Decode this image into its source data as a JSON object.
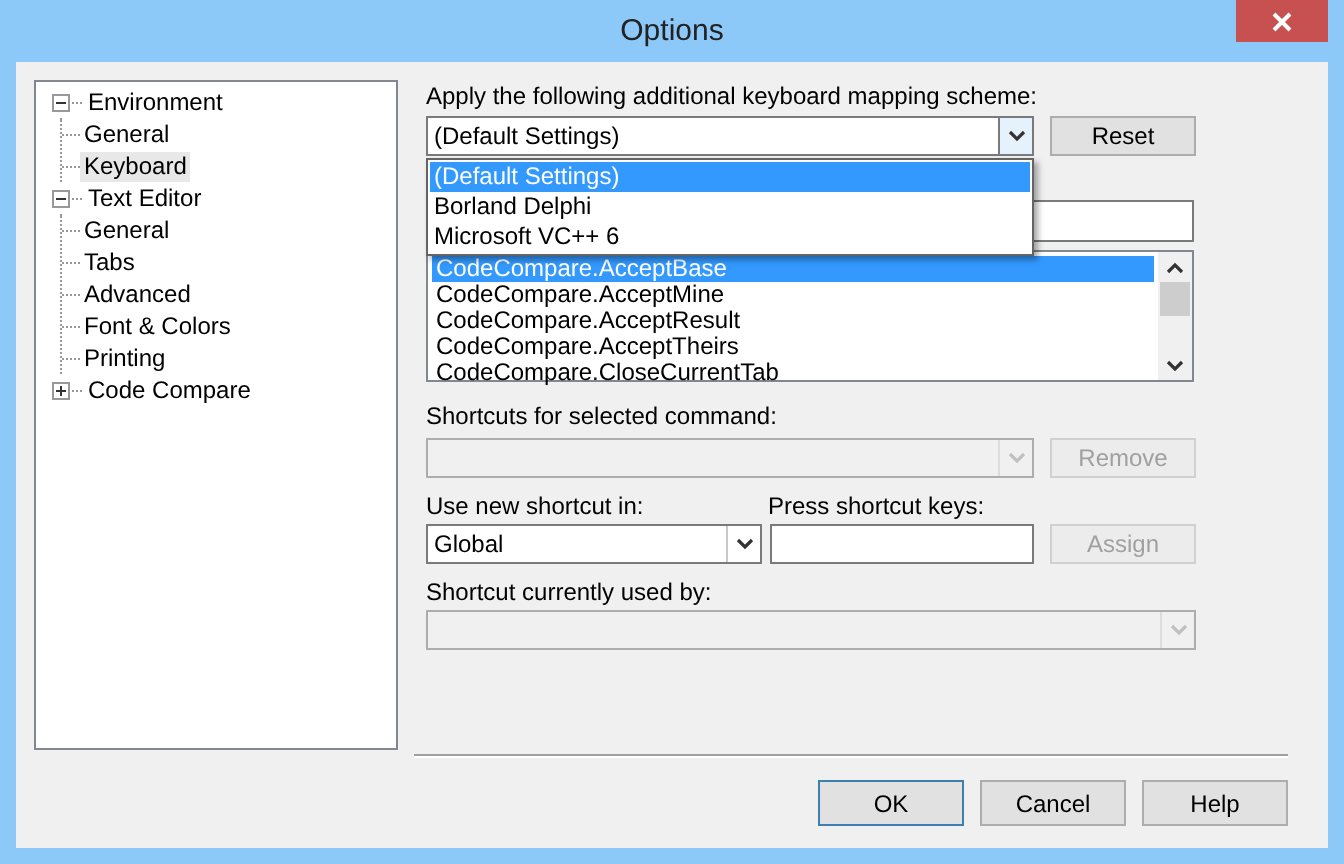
{
  "window": {
    "title": "Options"
  },
  "tree": [
    {
      "label": "Environment",
      "expanded": true,
      "selected": false,
      "children": [
        {
          "label": "General",
          "selected": false
        },
        {
          "label": "Keyboard",
          "selected": true
        }
      ]
    },
    {
      "label": "Text Editor",
      "expanded": true,
      "selected": false,
      "children": [
        {
          "label": "General",
          "selected": false
        },
        {
          "label": "Tabs",
          "selected": false
        },
        {
          "label": "Advanced",
          "selected": false
        },
        {
          "label": "Font & Colors",
          "selected": false
        },
        {
          "label": "Printing",
          "selected": false
        }
      ]
    },
    {
      "label": "Code Compare",
      "expanded": false,
      "selected": false
    }
  ],
  "scheme": {
    "label": "Apply the following additional keyboard mapping scheme:",
    "value": "(Default Settings)",
    "open": true,
    "options": [
      {
        "label": "(Default Settings)",
        "selected": true
      },
      {
        "label": "Borland Delphi",
        "selected": false
      },
      {
        "label": "Microsoft VC++ 6",
        "selected": false
      }
    ]
  },
  "reset_button": {
    "label": "Reset",
    "disabled": false
  },
  "commands": [
    {
      "label": "CodeCompare.AcceptBase",
      "selected": true
    },
    {
      "label": "CodeCompare.AcceptMine",
      "selected": false
    },
    {
      "label": "CodeCompare.AcceptResult",
      "selected": false
    },
    {
      "label": "CodeCompare.AcceptTheirs",
      "selected": false
    },
    {
      "label": "CodeCompare.CloseCurrentTab",
      "selected": false
    }
  ],
  "shortcuts": {
    "label": "Shortcuts for selected command:",
    "disabled": true
  },
  "remove_button": {
    "label": "Remove",
    "disabled": true
  },
  "use_in": {
    "label": "Use new shortcut in:",
    "value": "Global",
    "disabled": false
  },
  "keys": {
    "label": "Press shortcut keys:"
  },
  "assign_button": {
    "label": "Assign",
    "disabled": true
  },
  "used_by": {
    "label": "Shortcut currently used by:",
    "disabled": true
  },
  "buttons": [
    {
      "label": "OK",
      "default": true
    },
    {
      "label": "Cancel",
      "default": false
    },
    {
      "label": "Help",
      "default": false
    }
  ]
}
